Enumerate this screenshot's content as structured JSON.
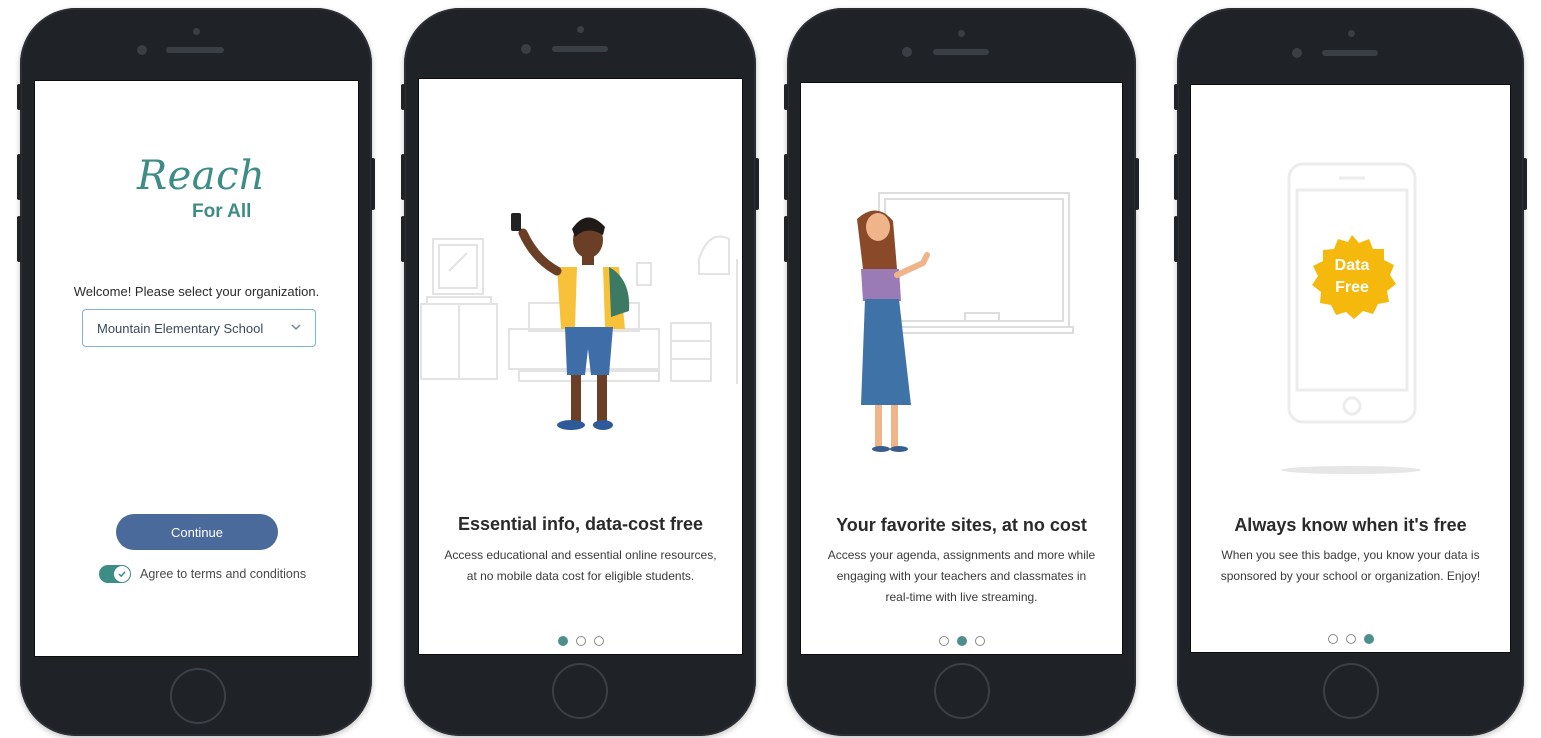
{
  "screens": [
    {
      "logo": {
        "line1": "Reach",
        "line2": "For All"
      },
      "prompt": "Welcome! Please select your organization.",
      "org_select": {
        "value": "Mountain Elementary School"
      },
      "continue_label": "Continue",
      "terms": {
        "label": "Agree to terms and conditions",
        "checked": true
      }
    },
    {
      "title": "Essential info, data-cost free",
      "desc_line1": "Access educational and essential online resources,",
      "desc_line2": "at no mobile data cost for eligible students.",
      "active_dot": 1
    },
    {
      "title": "Your favorite sites, at no cost",
      "desc_line1": "Access your agenda, assignments and more while",
      "desc_line2": "engaging with your teachers and classmates in",
      "desc_line3": "real-time with live streaming.",
      "active_dot": 2
    },
    {
      "title": "Always know when it's free",
      "desc_line1": "When you see this badge, you know your data is",
      "desc_line2": "sponsored by your school or organization. Enjoy!",
      "badge": {
        "line1": "Data",
        "line2": "Free"
      },
      "active_dot": 3
    }
  ],
  "colors": {
    "teal": "#3d8c86",
    "button": "#4a6a9b",
    "badge": "#f5b80c"
  }
}
